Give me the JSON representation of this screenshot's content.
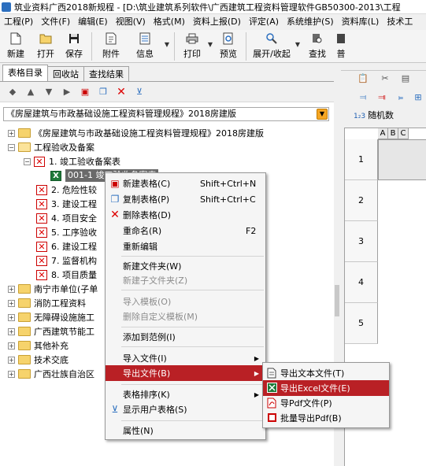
{
  "window": {
    "title": "筑业资料广西2018新规程 - [D:\\筑业建筑系列软件\\广西建筑工程资料管理软件GB50300-2013\\工程"
  },
  "menu": [
    "工程(P)",
    "文件(F)",
    "编辑(E)",
    "视图(V)",
    "格式(M)",
    "资料上报(D)",
    "评定(A)",
    "系统维护(S)",
    "资料库(L)",
    "技术工"
  ],
  "toolbar": [
    {
      "label": "新建",
      "icon": "new-doc-icon"
    },
    {
      "label": "打开",
      "icon": "open-folder-icon"
    },
    {
      "label": "保存",
      "icon": "save-disk-icon"
    },
    {
      "label": "附件",
      "icon": "attachment-icon"
    },
    {
      "label": "信息",
      "icon": "info-icon"
    },
    {
      "label": "打印",
      "icon": "printer-icon"
    },
    {
      "label": "预览",
      "icon": "preview-icon"
    },
    {
      "label": "展开/收起",
      "icon": "expand-collapse-icon"
    },
    {
      "label": "查找",
      "icon": "find-icon"
    },
    {
      "label": "普",
      "icon": "general-icon"
    }
  ],
  "tabs": [
    "表格目录",
    "回收站",
    "查找结果"
  ],
  "combo": {
    "value": "《房屋建筑与市政基础设施工程资料管理规程》2018房建版"
  },
  "tree": {
    "root": "《房屋建筑与市政基础设施工程资料管理规程》2018房建版",
    "section": "工程验收及备案",
    "subsection": "1. 竣工验收备案表",
    "selected": "001-1 竣工验收备案表",
    "items": [
      "2. 危险性较",
      "3. 建设工程",
      "4. 项目安全",
      "5. 工序验收",
      "6. 建设工程",
      "7. 监督机构",
      "8. 项目质量"
    ],
    "groups": [
      "南宁市单位(子单",
      "消防工程资料",
      "无障碍设施施工",
      "广西建筑节能工",
      "其他补充",
      "技术交底",
      "广西壮族自治区"
    ]
  },
  "right_panel": {
    "random_label": "随机数",
    "random_badge": "1₂3",
    "columns": [
      "A",
      "B",
      "C"
    ],
    "rows": [
      "1",
      "2",
      "3",
      "4",
      "5"
    ]
  },
  "context_menu": {
    "items": [
      {
        "label": "新建表格(C)",
        "shortcut": "Shift+Ctrl+N",
        "icon": "new-table-icon"
      },
      {
        "label": "复制表格(P)",
        "shortcut": "Shift+Ctrl+C",
        "icon": "copy-table-icon"
      },
      {
        "label": "删除表格(D)",
        "shortcut": "",
        "icon": "delete-x-icon"
      },
      {
        "label": "重命名(R)",
        "shortcut": "F2"
      },
      {
        "label": "重新编辑",
        "shortcut": ""
      },
      {
        "label": "新建文件夹(W)",
        "shortcut": ""
      },
      {
        "label": "新建子文件夹(Z)",
        "shortcut": ""
      },
      {
        "label": "导入模板(O)",
        "shortcut": ""
      },
      {
        "label": "删除自定义模板(M)",
        "shortcut": ""
      },
      {
        "label": "添加到范例(I)",
        "shortcut": ""
      },
      {
        "label": "导入文件(I)",
        "shortcut": ""
      },
      {
        "label": "导出文件(B)",
        "shortcut": ""
      },
      {
        "label": "表格排序(K)",
        "shortcut": ""
      },
      {
        "label": "显示用户表格(S)",
        "shortcut": "",
        "icon": "filter-icon"
      },
      {
        "label": "属性(N)",
        "shortcut": ""
      }
    ]
  },
  "submenu": {
    "items": [
      {
        "label": "导出文本文件(T)",
        "icon": "text-file-icon"
      },
      {
        "label": "导出Excel文件(E)",
        "icon": "excel-icon"
      },
      {
        "label": "导Pdf文件(P)",
        "icon": "pdf-icon"
      },
      {
        "label": "批量导出Pdf(B)",
        "icon": "batch-pdf-icon"
      }
    ]
  },
  "colors": {
    "highlight": "#b92025",
    "folder": "#f6d36c",
    "excel": "#1f7a3a"
  }
}
